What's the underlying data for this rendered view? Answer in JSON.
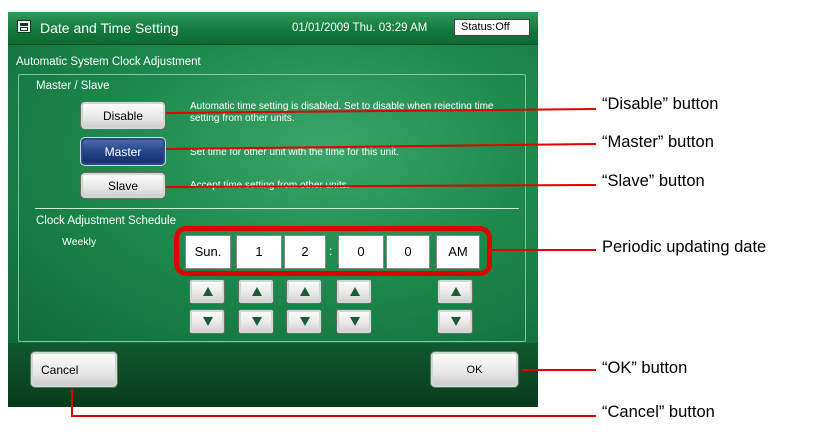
{
  "titlebar": {
    "title": "Date and Time Setting",
    "datetime": "01/01/2009 Thu. 03:29 AM",
    "status": "Status:Off"
  },
  "section": {
    "heading": "Automatic System Clock Adjustment",
    "master_slave_label": "Master / Slave",
    "schedule_label": "Clock Adjustment Schedule",
    "frequency": "Weekly"
  },
  "modes": [
    {
      "label": "Disable",
      "description": "Automatic time setting is disabled. Set to disable when rejecting time setting from other units.",
      "selected": false
    },
    {
      "label": "Master",
      "description": "Set time for other unit with the time for this unit.",
      "selected": true
    },
    {
      "label": "Slave",
      "description": "Accept time setting from other units.",
      "selected": false
    }
  ],
  "schedule": {
    "day": "Sun.",
    "hour_tens": "1",
    "hour_ones": "2",
    "separator": ":",
    "minute_tens": "0",
    "minute_ones": "0",
    "ampm": "AM"
  },
  "footer": {
    "cancel_label": "Cancel",
    "ok_label": "OK"
  },
  "annotations": {
    "disable": "“Disable” button",
    "master": "“Master” button",
    "slave": "“Slave” button",
    "periodic": "Periodic updating date",
    "ok": "“OK” button",
    "cancel": "“Cancel” button"
  },
  "colors": {
    "accent_red": "#e00000",
    "selected_button": "#1e3f84",
    "panel_green": "#1e8a4d"
  },
  "icons": {
    "title_icon": "window-icon",
    "up_arrow": "triangle-up-icon",
    "down_arrow": "triangle-down-icon"
  }
}
